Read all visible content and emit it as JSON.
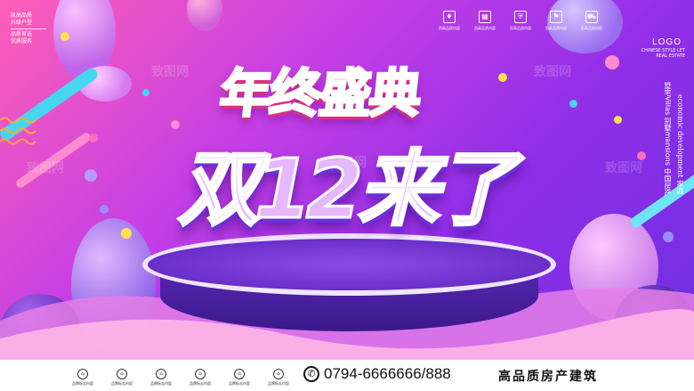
{
  "top_left": {
    "lines": [
      "凯高品质",
      "升级户型",
      "品质首选",
      "优质服务"
    ]
  },
  "icon_bar": [
    {
      "icon": "diamond-icon",
      "glyph": "♦",
      "label": "凯高品质内容"
    },
    {
      "icon": "building-icon",
      "glyph": "▦",
      "label": "凯高品质内容"
    },
    {
      "icon": "shield-icon",
      "glyph": "⛨",
      "label": "凯高品质内容"
    },
    {
      "icon": "flag-icon",
      "glyph": "⚑",
      "label": "凯高品质内容"
    },
    {
      "icon": "cart-icon",
      "glyph": "⛟",
      "label": "凯高品质内容"
    }
  ],
  "logo": {
    "text": "LOGO",
    "subtitle": "CHINESE STYLE LET REAL ESTATE"
  },
  "vertical_text": {
    "col1": "墅宅Villas 别墅mansions 中国房产",
    "col2": "economic development 家庭"
  },
  "headline": {
    "line1": "年终盛典",
    "line2": "双12来了"
  },
  "watermark": "致图网",
  "footer": {
    "brands": [
      {
        "icon": "emblem-icon",
        "label": "品牌标志内容"
      },
      {
        "icon": "emblem-icon",
        "label": "品牌标志内容"
      },
      {
        "icon": "emblem-icon",
        "label": "品牌标志内容"
      },
      {
        "icon": "emblem-icon",
        "label": "品牌标志内容"
      },
      {
        "icon": "emblem-icon",
        "label": "品牌标志内容"
      },
      {
        "icon": "emblem-icon",
        "label": "品牌标志内容"
      }
    ],
    "phone_icon": "phone-icon",
    "phone": "0794-6666666/888",
    "slogan": "高品质房产建筑"
  },
  "colors": {
    "bg_pink": "#ff5fb5",
    "bg_purple": "#8f2ee8",
    "accent_cyan": "#46d7f0",
    "accent_yellow": "#ffe34d"
  }
}
